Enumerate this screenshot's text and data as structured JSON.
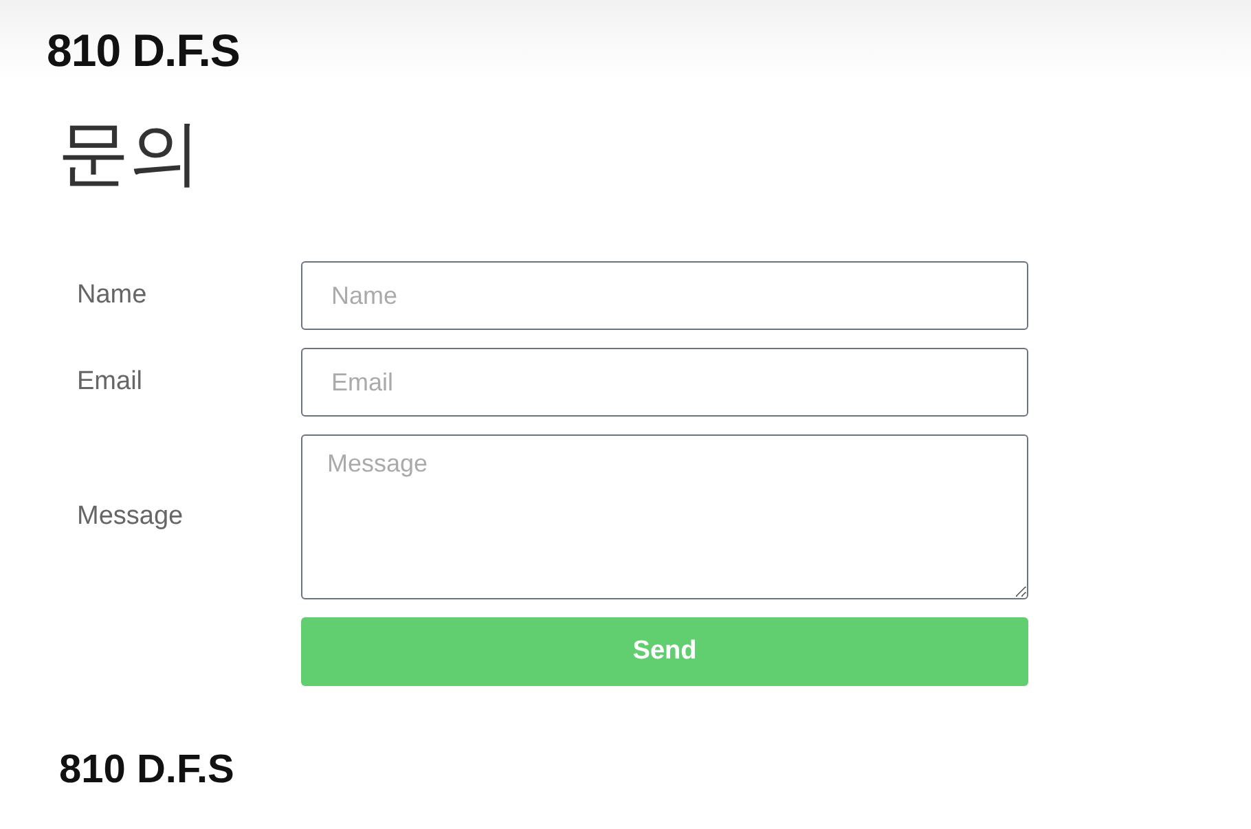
{
  "header": {
    "logo": "810 D.F.S"
  },
  "title": "문의",
  "form": {
    "fields": [
      {
        "kind": "input",
        "label": "Name",
        "placeholder": "Name"
      },
      {
        "kind": "input",
        "label": "Email",
        "placeholder": "Email"
      },
      {
        "kind": "textarea",
        "label": "Message",
        "placeholder": "Message"
      }
    ],
    "submit": "Send"
  },
  "footer": {
    "logo": "810 D.F.S"
  }
}
